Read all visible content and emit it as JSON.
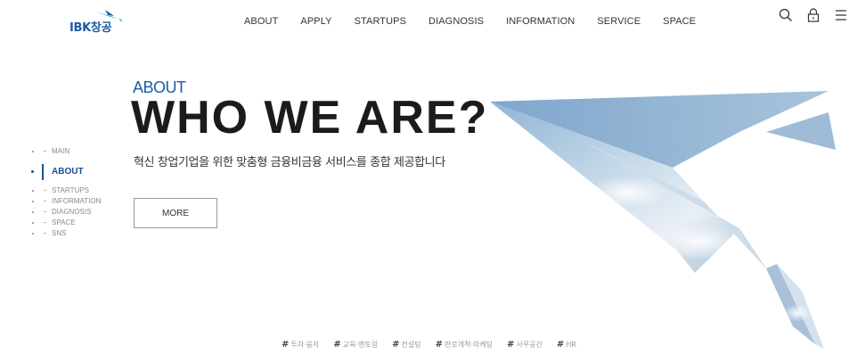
{
  "brand": {
    "logo_text": "IBK창공",
    "accent": "#1d5aa6",
    "mark_color": "#2aa7c9"
  },
  "header": {
    "nav": [
      "ABOUT",
      "APPLY",
      "STARTUPS",
      "DIAGNOSIS",
      "INFORMATION",
      "SERVICE",
      "SPACE"
    ],
    "icons": [
      "search-icon",
      "lock-icon",
      "menu-icon"
    ]
  },
  "side_nav": {
    "items": [
      "MAIN",
      "ABOUT",
      "STARTUPS",
      "INFORMATION",
      "DIAGNOSIS",
      "SPACE",
      "SNS"
    ],
    "active": "ABOUT"
  },
  "hero": {
    "eyebrow": "ABOUT",
    "title": "WHO WE ARE?",
    "description": "혁신 창업기업을 위한 맞춤형 금융비금융 서비스를 종합 제공합니다",
    "button": "MORE"
  },
  "hashtags": [
    {
      "hash": "#",
      "label": "투자·융자"
    },
    {
      "hash": "#",
      "label": "교육·멘토링"
    },
    {
      "hash": "#",
      "label": "컨설팅"
    },
    {
      "hash": "#",
      "label": "판로개척·마케팅"
    },
    {
      "hash": "#",
      "label": "사무공간"
    },
    {
      "hash": "#",
      "label": "HR"
    }
  ]
}
